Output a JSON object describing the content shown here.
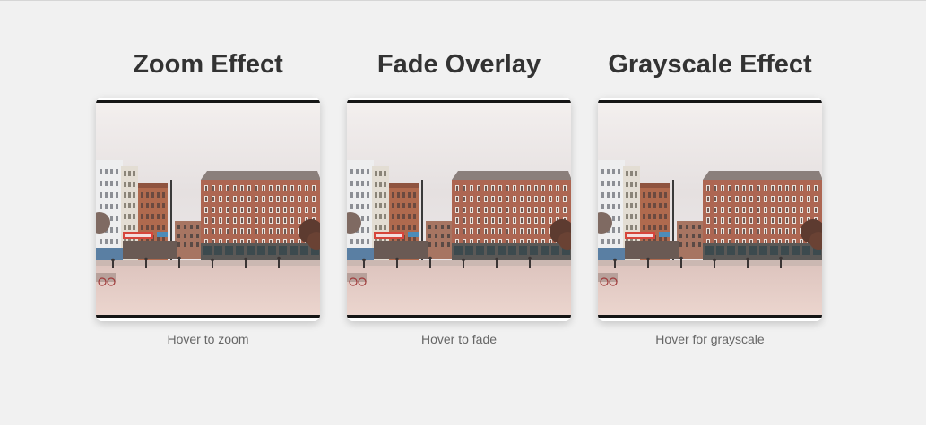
{
  "cards": [
    {
      "title": "Zoom Effect",
      "caption": "Hover to zoom",
      "image_alt": "city square with red brick buildings"
    },
    {
      "title": "Fade Overlay",
      "caption": "Hover to fade",
      "image_alt": "city square with red brick buildings"
    },
    {
      "title": "Grayscale Effect",
      "caption": "Hover for grayscale",
      "image_alt": "city square with red brick buildings"
    }
  ],
  "colors": {
    "background": "#f1f1f1",
    "title": "#333333",
    "caption": "#666666"
  }
}
